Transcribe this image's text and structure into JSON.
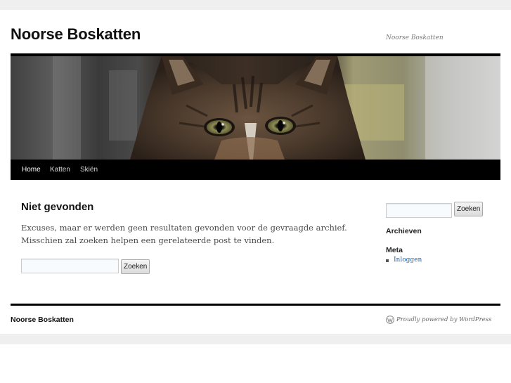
{
  "site": {
    "title": "Noorse Boskatten",
    "description": "Noorse Boskatten"
  },
  "nav": {
    "items": [
      {
        "label": "Home",
        "active": true
      },
      {
        "label": "Katten",
        "active": false
      },
      {
        "label": "Skiën",
        "active": false
      }
    ]
  },
  "main": {
    "heading": "Niet gevonden",
    "text": "Excuses, maar er werden geen resultaten gevonden voor de gevraagde archief. Misschien zal zoeken helpen een gerelateerde post te vinden.",
    "search": {
      "value": "",
      "placeholder": "",
      "button_label": "Zoeken"
    }
  },
  "sidebar": {
    "search": {
      "value": "",
      "placeholder": "",
      "button_label": "Zoeken"
    },
    "archives_title": "Archieven",
    "meta_title": "Meta",
    "meta_links": [
      {
        "label": "Inloggen"
      }
    ]
  },
  "footer": {
    "site_title": "Noorse Boskatten",
    "powered_by": "Proudly powered by WordPress",
    "icon": "wordpress-logo-icon"
  },
  "colors": {
    "accent_black": "#000000",
    "link_blue": "#1b63b5",
    "band_gray": "#efefef"
  }
}
